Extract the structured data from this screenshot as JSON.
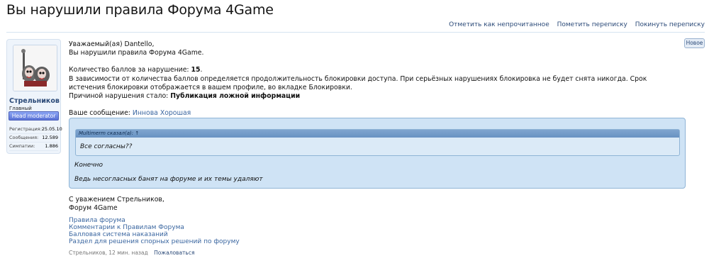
{
  "page": {
    "title": "Вы нарушили правила Форума 4Game"
  },
  "actions": {
    "mark_unread": "Отметить как непрочитанное",
    "mark_conversation": "Пометить переписку",
    "leave_conversation": "Покинуть переписку"
  },
  "badge_new": "Новое",
  "author": {
    "name": "Стрельников",
    "title": "Главный модератор",
    "badge": "Head moderator",
    "stats": [
      {
        "label": "Регистрация:",
        "value": "25.05.10"
      },
      {
        "label": "Сообщения:",
        "value": "12.589"
      },
      {
        "label": "Симпатии:",
        "value": "1.886"
      }
    ]
  },
  "message": {
    "greeting": "Уважаемый(ая) Dantello,",
    "violation": "Вы нарушили правила Форума 4Game.",
    "points_label": "Количество баллов за нарушение: ",
    "points_value": "15",
    "points_end": ".",
    "duration_info": "В зависимости от количества баллов определяется продолжительность блокировки доступа. При серьёзных нарушениях блокировка не будет снята никогда. Срок истечения блокировки отображается в вашем профиле, во вкладке Блокировки.",
    "reason_label": "Причиной нарушения стало: ",
    "reason_value": "Публикация ложной информации",
    "your_message_label": "Ваше сообщение: ",
    "your_message_link": "Иннова Хорошая"
  },
  "quote": {
    "header": "Multimerm сказал(а): ↑",
    "quoted_text": "Все согласны??",
    "reply_1": "Конечно",
    "reply_2": "Ведь несогласных банят на форуме и их темы удаляют"
  },
  "signature": {
    "line1": "С уважением Стрельников,",
    "line2": "Форум 4Game"
  },
  "links": [
    "Правила форума",
    "Комментарии к Правилам Форума",
    "Балловая система наказаний",
    "Раздел для решения спорных решений по форуму"
  ],
  "footer": {
    "meta": "Стрельников, 12 мин. назад",
    "complain": "Пожаловаться"
  }
}
